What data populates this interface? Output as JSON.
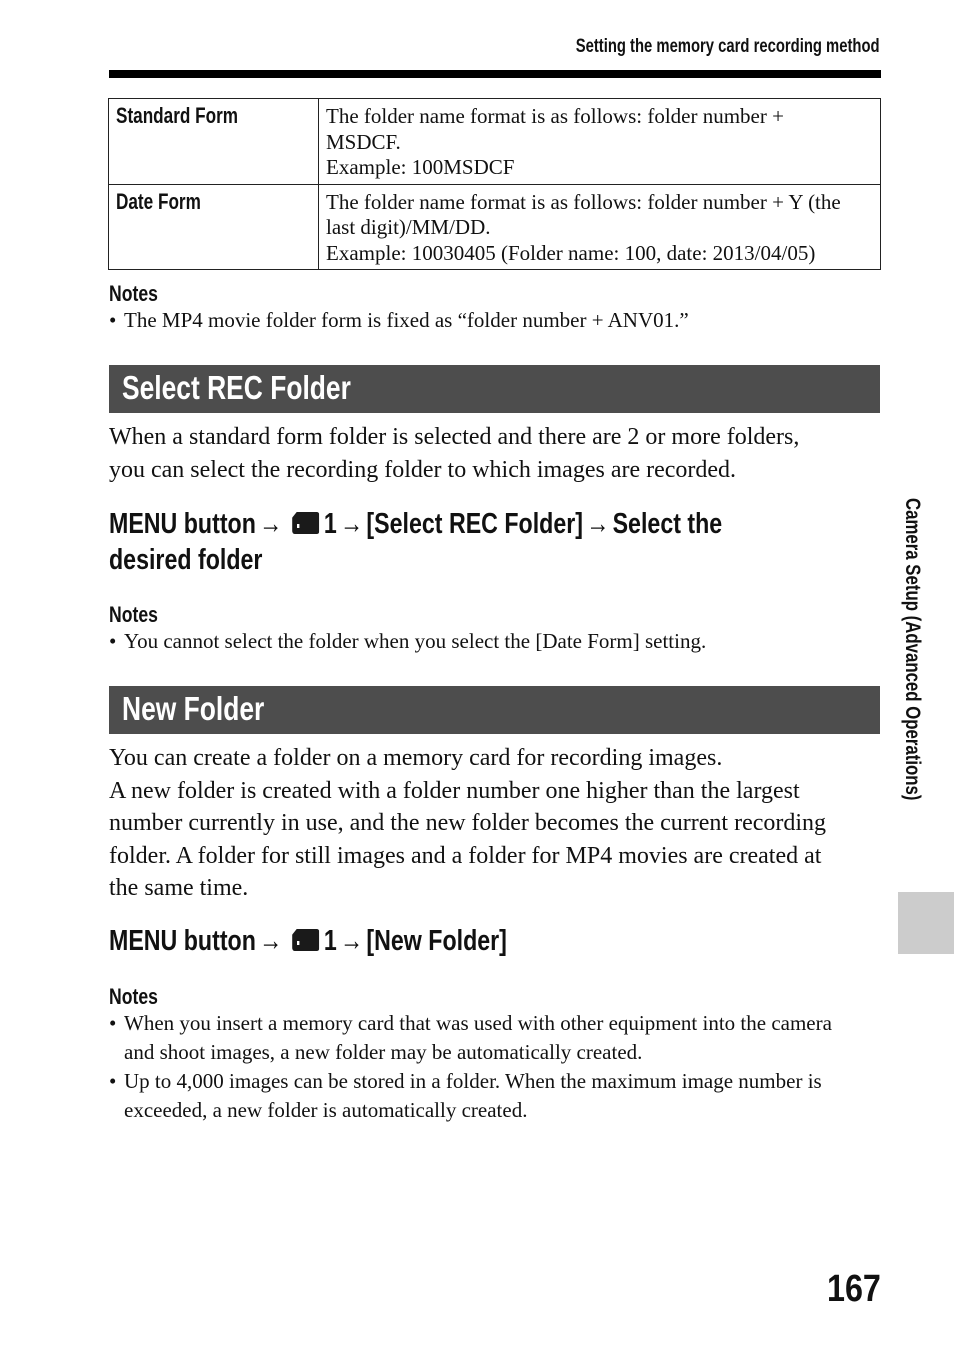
{
  "header": {
    "running_title": "Setting the memory card recording method"
  },
  "folder_format_table": {
    "rows": [
      {
        "name": "Standard Form",
        "lines": [
          "The folder name format is as follows: folder number +",
          "MSDCF.",
          "Example: 100MSDCF"
        ]
      },
      {
        "name": "Date Form",
        "lines": [
          "The folder name format is as follows: folder number + Y (the",
          "last digit)/MM/DD.",
          "Example: 10030405 (Folder name: 100, date: 2013/04/05)"
        ]
      }
    ]
  },
  "notes_1": {
    "title": "Notes",
    "items": [
      "The MP4 movie folder form is fixed as “folder number + ANV01.”"
    ]
  },
  "select_rec_folder": {
    "heading": "Select REC Folder",
    "body_lines": [
      "When a standard form folder is selected and there are 2 or more folders,",
      "you can select the recording folder to which images are recorded."
    ],
    "menu_path": {
      "line1_prefix": "MENU button",
      "arrow": "→",
      "icon": "memory-card-icon",
      "tab_number": "1",
      "line1_item": "[Select REC Folder]",
      "line1_suffix": "Select the",
      "line2": "desired folder"
    },
    "notes": {
      "title": "Notes",
      "items": [
        "You cannot select the folder when you select the [Date Form] setting."
      ]
    }
  },
  "new_folder": {
    "heading": "New Folder",
    "body_lines": [
      "You can create a folder on a memory card for recording images.",
      "A new folder is created with a folder number one higher than the largest",
      "number currently in use, and the new folder becomes the current recording",
      "folder. A folder for still images and a folder for MP4 movies are created at",
      "the same time."
    ],
    "menu_path": {
      "prefix": "MENU button",
      "arrow": "→",
      "icon": "memory-card-icon",
      "tab_number": "1",
      "item": "[New Folder]"
    },
    "notes": {
      "title": "Notes",
      "items": [
        {
          "line1": "When you insert a memory card that was used with other equipment into the camera",
          "line2": "and shoot images, a new folder may be automatically created."
        },
        {
          "line1": "Up to 4,000 images can be stored in a folder. When the maximum image number is",
          "line2": "exceeded, a new folder is automatically created."
        }
      ]
    }
  },
  "side": {
    "chapter_label": "Camera Setup (Advanced Operations)",
    "tab_color": "#cccccc"
  },
  "footer": {
    "page_number": "167"
  },
  "colors": {
    "section_bar": "#4d4d4d",
    "rule": "#000000"
  },
  "bullet": "•"
}
